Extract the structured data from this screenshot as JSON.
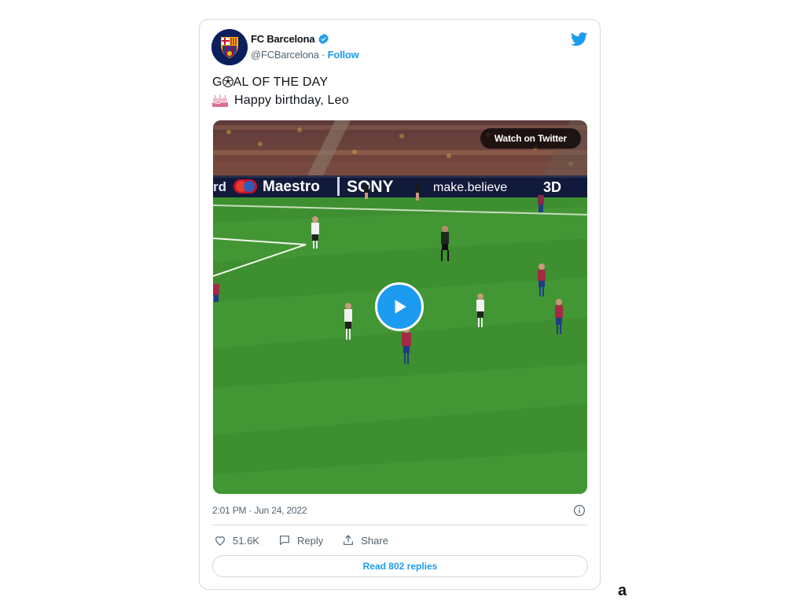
{
  "tweet": {
    "author_name": "FC Barcelona",
    "handle": "@FCBarcelona",
    "separator": " · ",
    "follow_label": "Follow",
    "text_line1_pre": "G",
    "text_line1_post": "AL OF THE DAY",
    "text_line2": "Happy birthday, Leo",
    "watch_label": "Watch on Twitter",
    "timestamp": "2:01 PM · Jun 24, 2022",
    "likes": "51.6K",
    "reply_label": "Reply",
    "share_label": "Share",
    "read_replies_label": "Read 802 replies",
    "brand_color": "#1d9bf0"
  },
  "stadium_boards": {
    "board1": "rd",
    "board2": "Maestro",
    "board3": "SONY",
    "board4": "make.believe",
    "board5": "3D"
  },
  "figure_label": "a"
}
